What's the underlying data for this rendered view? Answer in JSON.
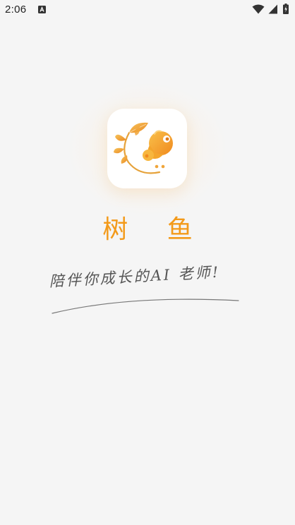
{
  "status_bar": {
    "time": "2:06",
    "icons": [
      "notification-a-icon",
      "wifi-icon",
      "signal-icon",
      "battery-icon"
    ]
  },
  "app": {
    "name": "树 鱼",
    "slogan": "陪伴你成长的AI 老师!",
    "logo_icon": "tree-fish-logo-icon",
    "colors": {
      "accent": "#f39a1a",
      "background": "#f5f5f5",
      "leaf": "#f2b34a",
      "fish": "#f5a623"
    }
  }
}
